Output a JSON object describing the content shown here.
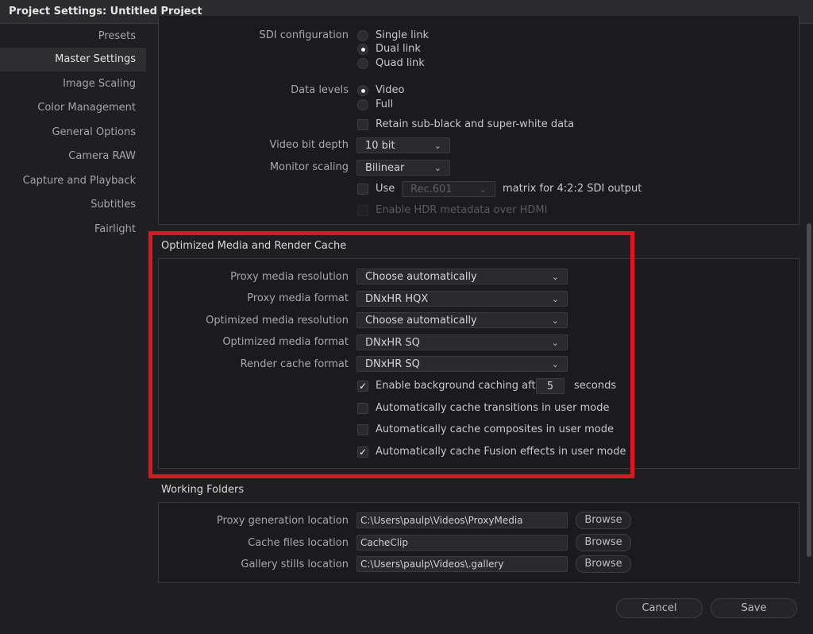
{
  "window": {
    "title": "Project Settings:  Untitled Project"
  },
  "sidebar": {
    "items": [
      {
        "label": "Presets",
        "active": false
      },
      {
        "label": "Master Settings",
        "active": true
      },
      {
        "label": "Image Scaling",
        "active": false
      },
      {
        "label": "Color Management",
        "active": false
      },
      {
        "label": "General Options",
        "active": false
      },
      {
        "label": "Camera RAW",
        "active": false
      },
      {
        "label": "Capture and Playback",
        "active": false
      },
      {
        "label": "Subtitles",
        "active": false
      },
      {
        "label": "Fairlight",
        "active": false
      }
    ]
  },
  "video_io": {
    "sdi_label": "SDI configuration",
    "sdi_options": [
      {
        "label": "Single link",
        "selected": false
      },
      {
        "label": "Dual link",
        "selected": true
      },
      {
        "label": "Quad link",
        "selected": false
      }
    ],
    "data_levels_label": "Data levels",
    "data_levels_options": [
      {
        "label": "Video",
        "selected": true
      },
      {
        "label": "Full",
        "selected": false
      }
    ],
    "retain_label": "Retain sub-black and super-white data",
    "retain_checked": false,
    "bit_depth_label": "Video bit depth",
    "bit_depth_value": "10 bit",
    "monitor_scaling_label": "Monitor scaling",
    "monitor_scaling_value": "Bilinear",
    "use_label": "Use",
    "use_checked": false,
    "matrix_value": "Rec.601",
    "matrix_suffix": "matrix for 4:2:2 SDI output",
    "hdr_label": "Enable HDR metadata over HDMI",
    "hdr_checked": false
  },
  "optimized": {
    "title": "Optimized Media and Render Cache",
    "proxy_res_label": "Proxy media resolution",
    "proxy_res_value": "Choose automatically",
    "proxy_format_label": "Proxy media format",
    "proxy_format_value": "DNxHR HQX",
    "opt_res_label": "Optimized media resolution",
    "opt_res_value": "Choose automatically",
    "opt_format_label": "Optimized media format",
    "opt_format_value": "DNxHR SQ",
    "render_cache_label": "Render cache format",
    "render_cache_value": "DNxHR SQ",
    "bg_cache_label": "Enable background caching after",
    "bg_cache_checked": true,
    "bg_cache_seconds": "5",
    "bg_cache_unit": "seconds",
    "cache_transitions_label": "Automatically cache transitions in user mode",
    "cache_transitions_checked": false,
    "cache_composites_label": "Automatically cache composites in user mode",
    "cache_composites_checked": false,
    "cache_fusion_label": "Automatically cache Fusion effects in user mode",
    "cache_fusion_checked": true
  },
  "working_folders": {
    "title": "Working Folders",
    "proxy_loc_label": "Proxy generation location",
    "proxy_loc_value": "C:\\Users\\paulp\\Videos\\ProxyMedia",
    "cache_loc_label": "Cache files location",
    "cache_loc_value": "CacheClip",
    "gallery_loc_label": "Gallery stills location",
    "gallery_loc_value": "C:\\Users\\paulp\\Videos\\.gallery",
    "browse_label": "Browse"
  },
  "footer": {
    "cancel_label": "Cancel",
    "save_label": "Save"
  },
  "colors": {
    "highlight": "#e0131e",
    "background": "#1f1f22",
    "panel": "#1b1b1d"
  },
  "icons": {
    "chevron": "chevron-down-icon",
    "check": "checkmark-icon"
  }
}
